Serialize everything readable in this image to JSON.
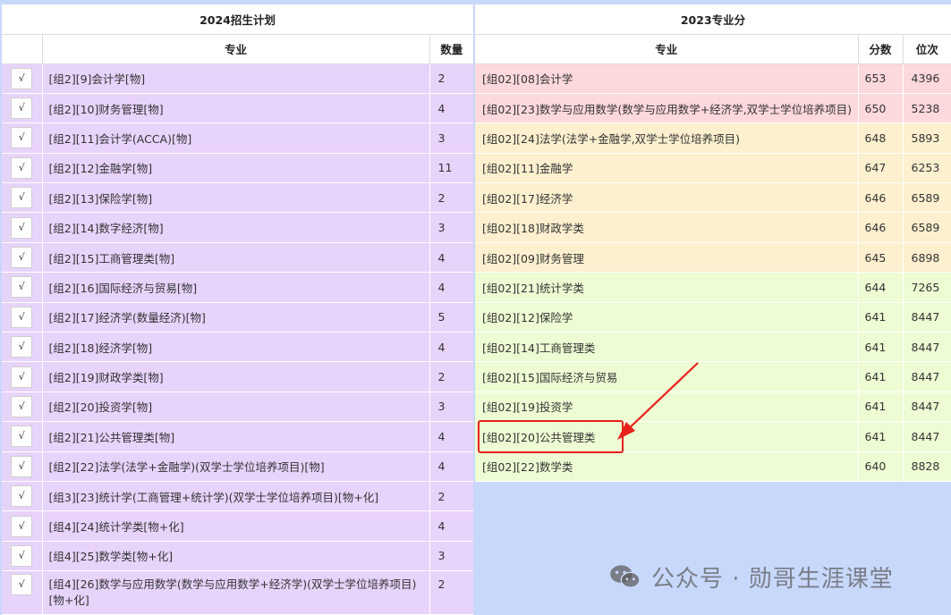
{
  "left_table": {
    "title": "2024招生计划",
    "headers": {
      "major": "专业",
      "count": "数量"
    },
    "rows": [
      {
        "check": "√",
        "major": "[组2][9]会计学[物]",
        "count": "2"
      },
      {
        "check": "√",
        "major": "[组2][10]财务管理[物]",
        "count": "4"
      },
      {
        "check": "√",
        "major": "[组2][11]会计学(ACCA)[物]",
        "count": "3"
      },
      {
        "check": "√",
        "major": "[组2][12]金融学[物]",
        "count": "11"
      },
      {
        "check": "√",
        "major": "[组2][13]保险学[物]",
        "count": "2"
      },
      {
        "check": "√",
        "major": "[组2][14]数字经济[物]",
        "count": "3"
      },
      {
        "check": "√",
        "major": "[组2][15]工商管理类[物]",
        "count": "4"
      },
      {
        "check": "√",
        "major": "[组2][16]国际经济与贸易[物]",
        "count": "4"
      },
      {
        "check": "√",
        "major": "[组2][17]经济学(数量经济)[物]",
        "count": "5"
      },
      {
        "check": "√",
        "major": "[组2][18]经济学[物]",
        "count": "4"
      },
      {
        "check": "√",
        "major": "[组2][19]财政学类[物]",
        "count": "2"
      },
      {
        "check": "√",
        "major": "[组2][20]投资学[物]",
        "count": "3"
      },
      {
        "check": "√",
        "major": "[组2][21]公共管理类[物]",
        "count": "4"
      },
      {
        "check": "√",
        "major": "[组2][22]法学(法学+金融学)(双学士学位培养项目)[物]",
        "count": "4"
      },
      {
        "check": "√",
        "major": "[组3][23]统计学(工商管理+统计学)(双学士学位培养项目)[物+化]",
        "count": "2"
      },
      {
        "check": "√",
        "major": "[组4][24]统计学类[物+化]",
        "count": "4"
      },
      {
        "check": "√",
        "major": "[组4][25]数学类[物+化]",
        "count": "3"
      },
      {
        "check": "√",
        "major": "[组4][26]数学与应用数学(数学与应用数学+经济学)(双学士学位培养项目)[物+化]",
        "count": "2"
      }
    ]
  },
  "right_table": {
    "title": "2023专业分",
    "headers": {
      "major": "专业",
      "score": "分数",
      "rank": "位次"
    },
    "rows": [
      {
        "major": "[组02][08]会计学",
        "score": "653",
        "rank": "4396",
        "color": "#fdd8dc"
      },
      {
        "major": "[组02][23]数学与应用数学(数学与应用数学+经济学,双学士学位培养项目)",
        "score": "650",
        "rank": "5238",
        "color": "#fdd8dc"
      },
      {
        "major": "[组02][24]法学(法学+金融学,双学士学位培养项目)",
        "score": "648",
        "rank": "5893",
        "color": "#fdf0cf"
      },
      {
        "major": "[组02][11]金融学",
        "score": "647",
        "rank": "6253",
        "color": "#fdf0cf"
      },
      {
        "major": "[组02][17]经济学",
        "score": "646",
        "rank": "6589",
        "color": "#fdf0cf"
      },
      {
        "major": "[组02][18]财政学类",
        "score": "646",
        "rank": "6589",
        "color": "#fdf0cf"
      },
      {
        "major": "[组02][09]财务管理",
        "score": "645",
        "rank": "6898",
        "color": "#fdf0cf"
      },
      {
        "major": "[组02][21]统计学类",
        "score": "644",
        "rank": "7265",
        "color": "#eefcd4"
      },
      {
        "major": "[组02][12]保险学",
        "score": "641",
        "rank": "8447",
        "color": "#eefcd4"
      },
      {
        "major": "[组02][14]工商管理类",
        "score": "641",
        "rank": "8447",
        "color": "#eefcd4"
      },
      {
        "major": "[组02][15]国际经济与贸易",
        "score": "641",
        "rank": "8447",
        "color": "#eefcd4"
      },
      {
        "major": "[组02][19]投资学",
        "score": "641",
        "rank": "8447",
        "color": "#eefcd4"
      },
      {
        "major": "[组02][20]公共管理类",
        "score": "641",
        "rank": "8447",
        "color": "#eefcd4",
        "highlighted": true
      },
      {
        "major": "[组02][22]数学类",
        "score": "640",
        "rank": "8828",
        "color": "#eefcd4"
      }
    ]
  },
  "annotation": {
    "color": "#e8211c",
    "target": "[组02][20]公共管理类"
  },
  "watermark": {
    "text": "公众号 · 勋哥生涯课堂",
    "icon": "wechat-icon"
  },
  "colors": {
    "left_bg": "#e8d3fb",
    "right_bg": "#c8d8fb",
    "red_row": "#fdd8dc",
    "orange_row": "#fdf0cf",
    "green_row": "#eefcd4"
  }
}
